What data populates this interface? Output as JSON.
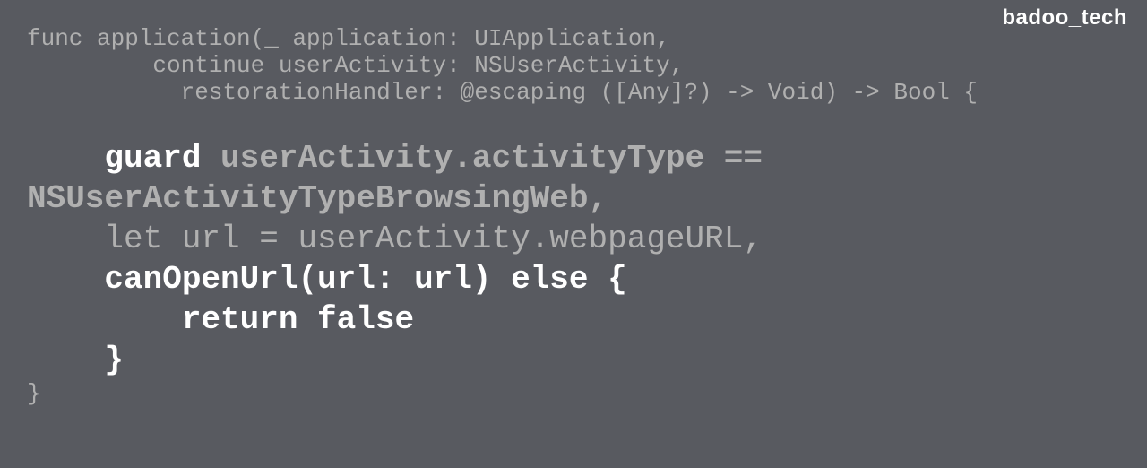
{
  "watermark": "badoo_tech",
  "code": {
    "l1": "func application(_ application: UIApplication,",
    "l2": "         continue userActivity: NSUserActivity,",
    "l3": "           restorationHandler: @escaping ([Any]?) -> Void) -> Bool {",
    "l4_a": "    guard",
    "l4_b": " userActivity.activityType == ",
    "l5": "NSUserActivityTypeBrowsingWeb,",
    "l6": "    let url = userActivity.webpageURL,",
    "l7": "    canOpenUrl(url: url) else {",
    "l8": "        return false",
    "l9": "    }",
    "l10": "}"
  }
}
